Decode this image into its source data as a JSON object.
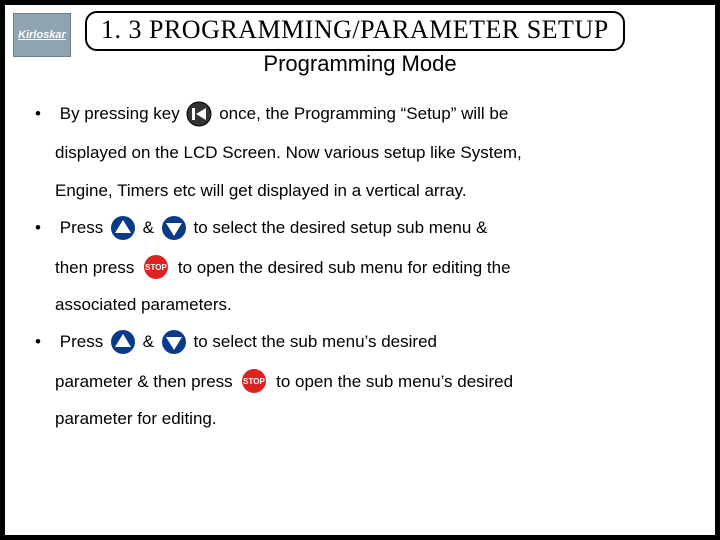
{
  "logo_text": "Kirloskar",
  "title": "1. 3 PROGRAMMING/PARAMETER SETUP",
  "subtitle": "Programming Mode",
  "bullet1": {
    "a": "By pressing key",
    "b": "once, the Programming “Setup” will be",
    "c": "displayed on the LCD Screen.  Now various setup like System,",
    "d": "Engine, Timers etc will get displayed in a vertical array."
  },
  "bullet2": {
    "a": " Press",
    "amp": "&",
    "b": "to select the desired setup sub menu &",
    "c": "then press",
    "d": "to open the desired sub menu for editing the",
    "e": "associated parameters."
  },
  "bullet3": {
    "a": " Press",
    "amp": "&",
    "b": "to select the sub menu’s desired",
    "c": "parameter  & then press",
    "d": "to open the sub menu’s desired",
    "e": "parameter for editing."
  },
  "icons": {
    "prev": "prev-track-icon",
    "up": "up-arrow-icon",
    "down": "down-arrow-icon",
    "stop_label": "STOP"
  },
  "colors": {
    "arrow_ring": "#0a3a8a",
    "arrow_fill": "#ffffff",
    "stop_fill": "#d22",
    "prev_fill": "#333"
  }
}
